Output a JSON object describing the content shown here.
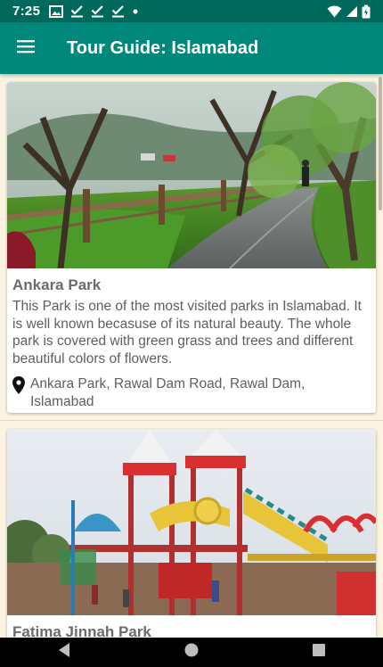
{
  "status_bar": {
    "time": "7:25",
    "left_icons": [
      "gallery-icon",
      "check-download-icon",
      "check-download-icon",
      "check-download-icon",
      "dot-icon"
    ],
    "right_icons": [
      "wifi-icon",
      "signal-icon",
      "battery-icon"
    ]
  },
  "app_bar": {
    "title": "Tour Guide: Islamabad",
    "menu_icon": "menu-icon",
    "color": "#00897b",
    "status_color": "#00695c"
  },
  "places": [
    {
      "title": "Ankara Park",
      "description": "This Park is one of the most visited parks in Islamabad. It is well known becasuse of its natural beauty. The whole park is covered with green grass and trees and different beautiful colors of flowers.",
      "location": "Ankara Park, Rawal Dam Road, Rawal Dam, Islamabad",
      "location_icon": "map-pin-icon"
    },
    {
      "title": "Fatima Jinnah Park",
      "description": "",
      "location": "",
      "location_icon": "map-pin-icon"
    }
  ],
  "nav_bar": {
    "back_icon": "back-icon",
    "home_icon": "home-icon",
    "recents_icon": "recents-icon"
  }
}
